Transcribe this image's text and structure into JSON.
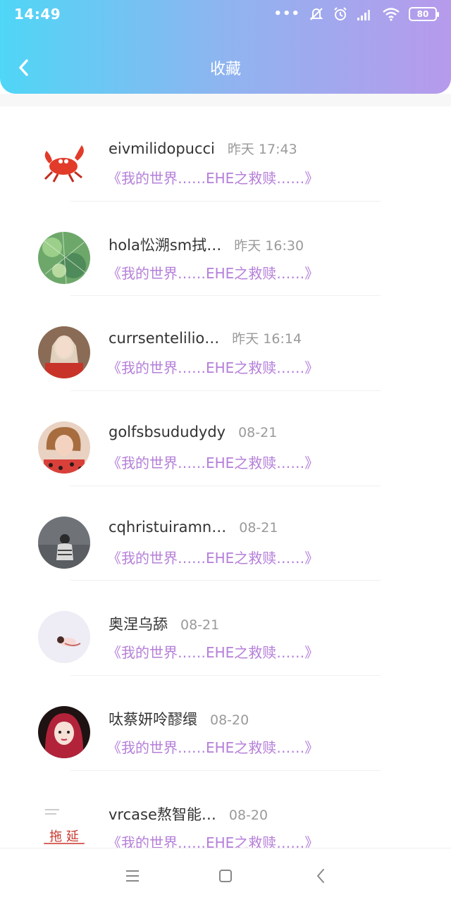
{
  "status_bar": {
    "time": "14:49",
    "battery": "80"
  },
  "header": {
    "title": "收藏"
  },
  "items": [
    {
      "name": "eivmilidopucci",
      "time": "昨天 17:43",
      "subtitle": "《我的世界……EHE之救赎……》"
    },
    {
      "name": "hola忪溯sm拭…",
      "time": "昨天 16:30",
      "subtitle": "《我的世界……EHE之救赎……》"
    },
    {
      "name": "currsentelilio…",
      "time": "昨天 16:14",
      "subtitle": "《我的世界……EHE之救赎……》"
    },
    {
      "name": "golfsbsududydy",
      "time": "08-21",
      "subtitle": "《我的世界……EHE之救赎……》"
    },
    {
      "name": "cqhristuiramn…",
      "time": "08-21",
      "subtitle": "《我的世界……EHE之救赎……》"
    },
    {
      "name": "奥涅乌舔",
      "time": "08-21",
      "subtitle": "《我的世界……EHE之救赎……》"
    },
    {
      "name": "呔蔡妍呤醪缳",
      "time": "08-20",
      "subtitle": "《我的世界……EHE之救赎……》"
    },
    {
      "name": "vrcase熬智能…",
      "time": "08-20",
      "subtitle": "《我的世界……EHE之救赎……》",
      "avatar_text": "拖 延"
    }
  ],
  "colors": {
    "accent_purple": "#b57fd9",
    "gradient_start": "#4fd6f6",
    "gradient_end": "#b79aeb"
  },
  "icons": {
    "back": "chevron-left-icon",
    "menu": "menu-icon",
    "home": "square-icon",
    "nav_back": "chevron-left-icon"
  }
}
